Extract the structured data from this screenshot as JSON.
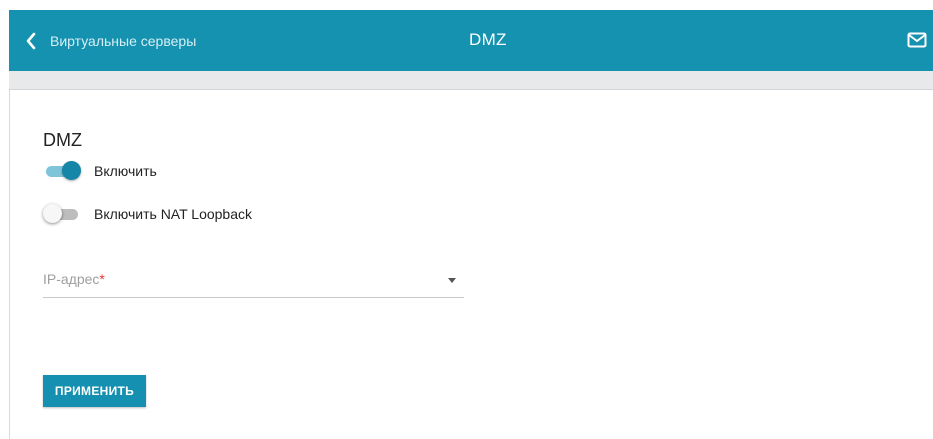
{
  "header": {
    "back_label": "Виртуальные серверы",
    "title": "DMZ",
    "back_icon": "chevron-left-icon",
    "mail_icon": "mail-icon"
  },
  "section": {
    "title": "DMZ"
  },
  "toggles": [
    {
      "label": "Включить",
      "state": "on"
    },
    {
      "label": "Включить NAT Loopback",
      "state": "off"
    }
  ],
  "ip_field": {
    "label": "IP-адрес",
    "required_mark": "*",
    "value": ""
  },
  "actions": {
    "apply_label": "ПРИМЕНИТЬ"
  },
  "colors": {
    "accent": "#1592b0",
    "toggle_on_knob": "#1585a8",
    "toggle_on_track": "#80c4d9",
    "required": "#e53935"
  }
}
